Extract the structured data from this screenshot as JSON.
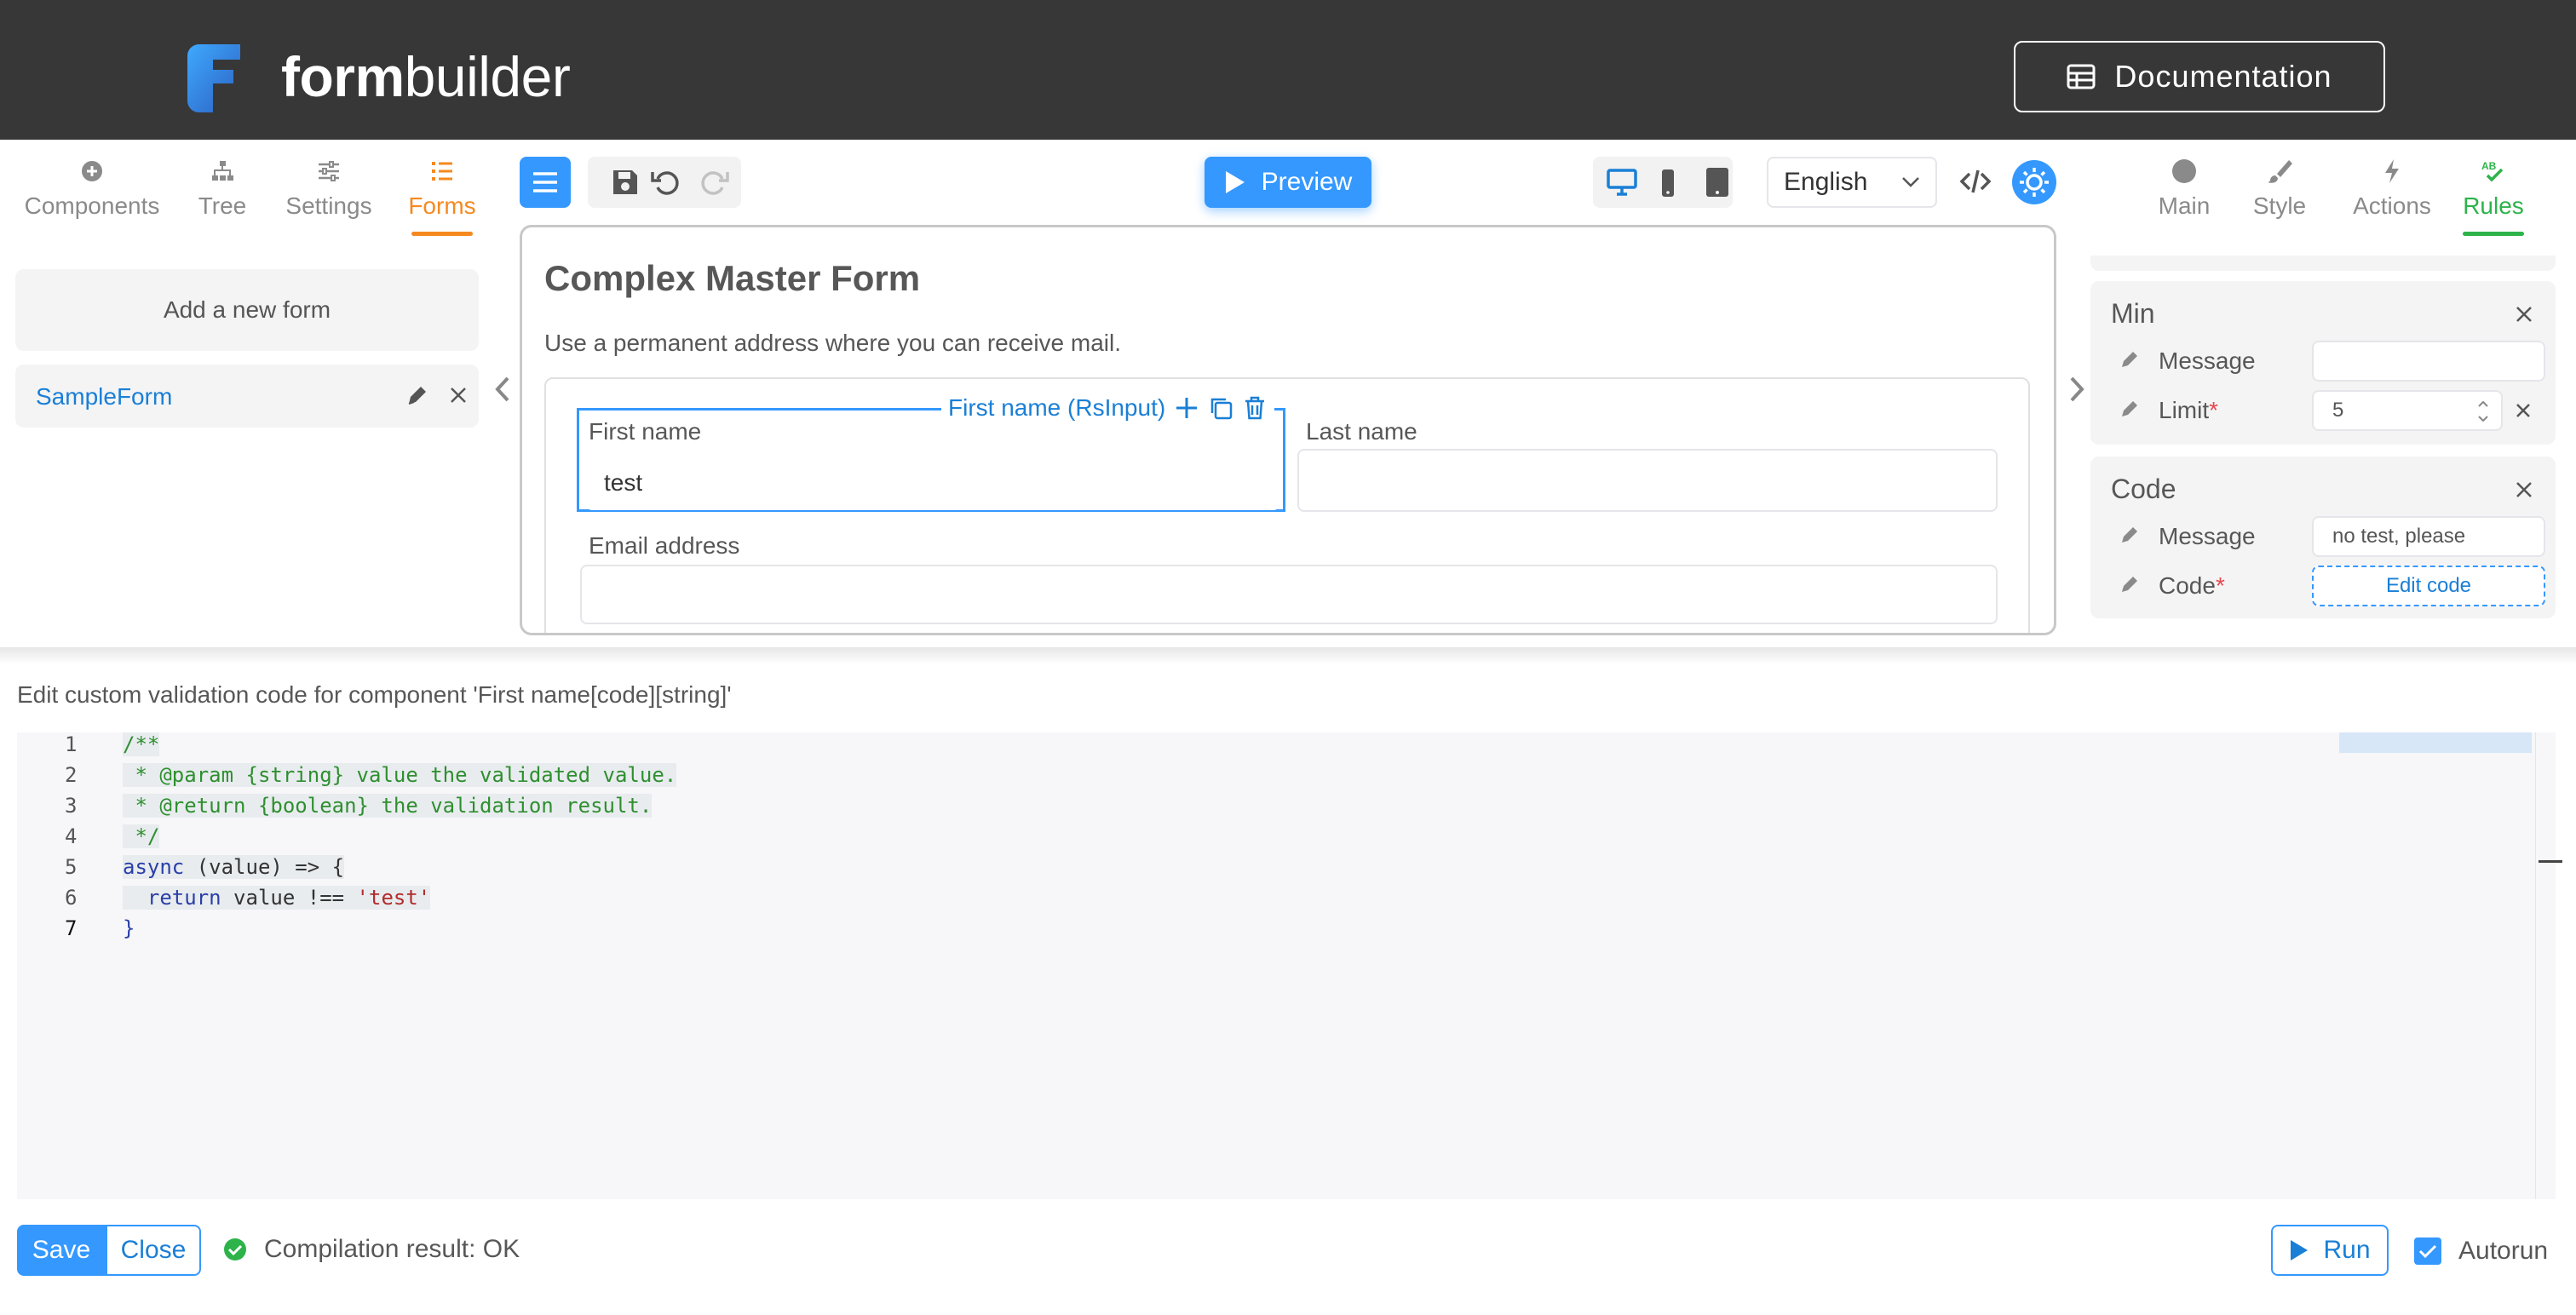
{
  "header": {
    "brand_bold": "form",
    "brand_light": "builder",
    "doc_button": "Documentation"
  },
  "left_tabs": [
    {
      "label": "Components",
      "icon": "plus-circle-icon"
    },
    {
      "label": "Tree",
      "icon": "tree-icon"
    },
    {
      "label": "Settings",
      "icon": "sliders-icon"
    },
    {
      "label": "Forms",
      "icon": "list-icon",
      "active": true
    }
  ],
  "forms_panel": {
    "add_label": "Add a new form",
    "items": [
      {
        "name": "SampleForm"
      }
    ]
  },
  "toolbar": {
    "preview_label": "Preview",
    "language": "English"
  },
  "right_tabs": [
    {
      "label": "Main",
      "icon": "circle-icon"
    },
    {
      "label": "Style",
      "icon": "brush-icon"
    },
    {
      "label": "Actions",
      "icon": "bolt-icon"
    },
    {
      "label": "Rules",
      "icon": "spellcheck-icon",
      "active": true
    }
  ],
  "form": {
    "title": "Complex Master Form",
    "subtitle": "Use a permanent address where you can receive mail.",
    "selected_component": "First name (RsInput)",
    "fields": {
      "first_name_label": "First name",
      "first_name_value": "test",
      "last_name_label": "Last name",
      "last_name_value": "",
      "email_label": "Email address",
      "email_value": ""
    }
  },
  "rules": {
    "min": {
      "title": "Min",
      "message_label": "Message",
      "message_value": "",
      "limit_label": "Limit",
      "required_mark": "*",
      "limit_value": "5"
    },
    "code": {
      "title": "Code",
      "message_label": "Message",
      "message_value": "no test, please",
      "code_label": "Code",
      "required_mark": "*",
      "edit_button": "Edit code"
    }
  },
  "editor": {
    "caption": "Edit custom validation code for component 'First name[code][string]'",
    "line_numbers": [
      "1",
      "2",
      "3",
      "4",
      "5",
      "6",
      "7"
    ],
    "lines": {
      "l1": "/**",
      "l2": " * @param {string} value the validated value.",
      "l3": " * @return {boolean} the validation result.",
      "l4": " */",
      "l5_kw": "async",
      "l5_rest": " (value) => {",
      "l6_kw": "  return",
      "l6_mid": " value !== ",
      "l6_str": "'test'",
      "l7": "}"
    }
  },
  "footer": {
    "save": "Save",
    "close": "Close",
    "compilation": "Compilation result: OK",
    "run": "Run",
    "autorun": "Autorun"
  },
  "colors": {
    "accent": "#3498ff",
    "forms_active": "#f5891f",
    "rules_active": "#2db34a",
    "header_bg": "#373737"
  }
}
